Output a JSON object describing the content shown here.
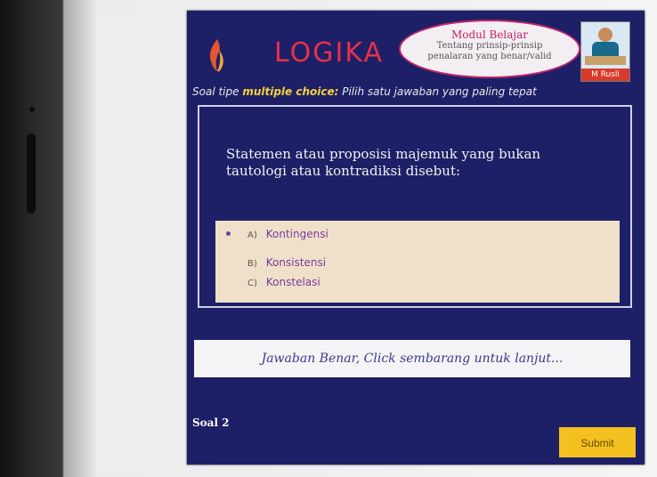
{
  "header": {
    "title": "LOGIKA",
    "module_title": "Modul Belajar",
    "module_subtitle_1": "Tentang prinsip-prinsip",
    "module_subtitle_2": "penalaran yang benar/valid",
    "author": "M Rusli"
  },
  "instruction": {
    "prefix": "Soal tipe ",
    "highlight": "multiple choice:",
    "suffix": " Pilih satu jawaban yang paling tepat"
  },
  "question": {
    "text": "Statemen atau proposisi majemuk yang bukan tautologi atau kontradiksi disebut:"
  },
  "options": [
    {
      "key": "A)",
      "label": "Kontingensi",
      "selected": true
    },
    {
      "key": "B)",
      "label": "Konsistensi",
      "selected": false
    },
    {
      "key": "C)",
      "label": "Konstelasi",
      "selected": false
    }
  ],
  "feedback": "Jawaban Benar, Click sembarang untuk lanjut...",
  "footer": {
    "soal_label": "Soal 2",
    "submit_label": "Submit"
  },
  "colors": {
    "app_bg": "#1d2066",
    "title": "#e8304a",
    "options_bg": "#efe1c9",
    "submit_bg": "#f3c01f"
  }
}
